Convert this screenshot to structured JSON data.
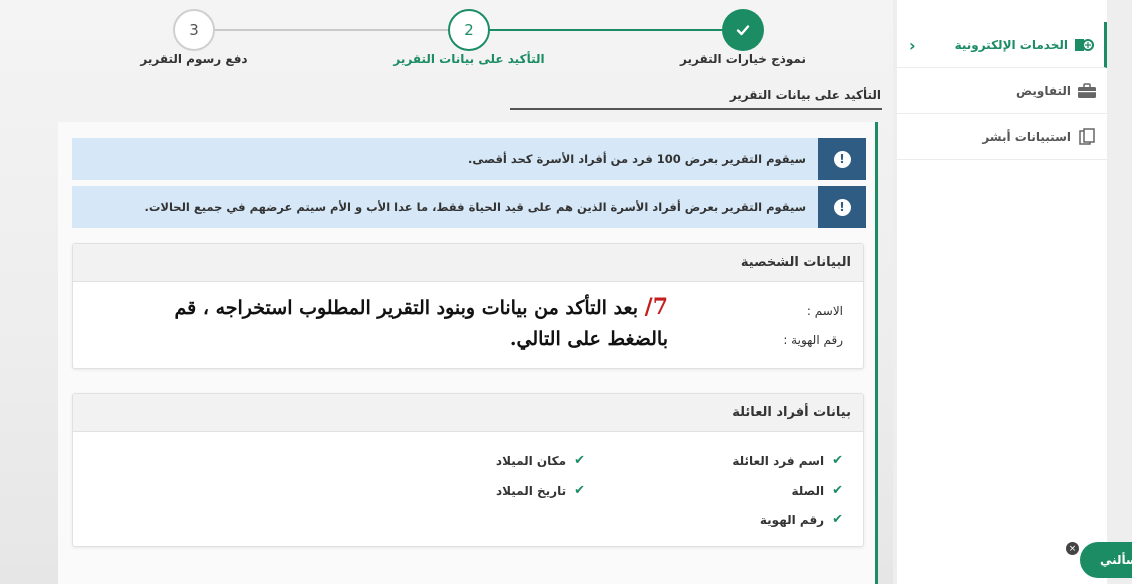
{
  "stepper": {
    "steps": [
      {
        "number": "",
        "label": "نموذج خيارات التقرير",
        "state": "done"
      },
      {
        "number": "2",
        "label": "التأكيد على بيانات التقرير",
        "state": "current"
      },
      {
        "number": "3",
        "label": "دفع رسوم التقرير",
        "state": "pending"
      }
    ]
  },
  "section": {
    "title": "التأكيد على بيانات التقرير"
  },
  "alerts": [
    {
      "text": "سيقوم التقرير بعرض 100 فرد من أفراد الأسرة كحد أقصى."
    },
    {
      "text": "سيقوم التقرير بعرض أفراد الأسرة الذين هم على قيد الحياة فقط، ما عدا الأب و الأم سيتم عرضهم في جميع الحالات."
    }
  ],
  "personal": {
    "title": "البيانات الشخصية",
    "name_label": "الاسم :",
    "id_label": "رقم الهوية :"
  },
  "instruction": {
    "number": "7/",
    "text": "بعد التأكد من بيانات وبنود التقرير المطلوب استخراجه ، قم بالضغط على التالي."
  },
  "family": {
    "title": "بيانات أفراد العائلة",
    "right_items": [
      "اسم فرد العائلة",
      "الصلة",
      "رقم الهوية"
    ],
    "left_items": [
      "مكان الميلاد",
      "تاريخ الميلاد"
    ]
  },
  "sidebar": {
    "items": [
      {
        "label": "الخدمات الإلكترونية",
        "icon": "digital-services-icon"
      },
      {
        "label": "التفاويض",
        "icon": "briefcase-icon"
      },
      {
        "label": "استبيانات أبشر",
        "icon": "survey-icon"
      }
    ]
  },
  "chat": {
    "label": "سألني"
  },
  "colors": {
    "accent": "#1b8c64",
    "alert_bg": "#d6e8f7",
    "alert_icon_bg": "#2e5c82",
    "instruction_number": "#c41e1e"
  }
}
